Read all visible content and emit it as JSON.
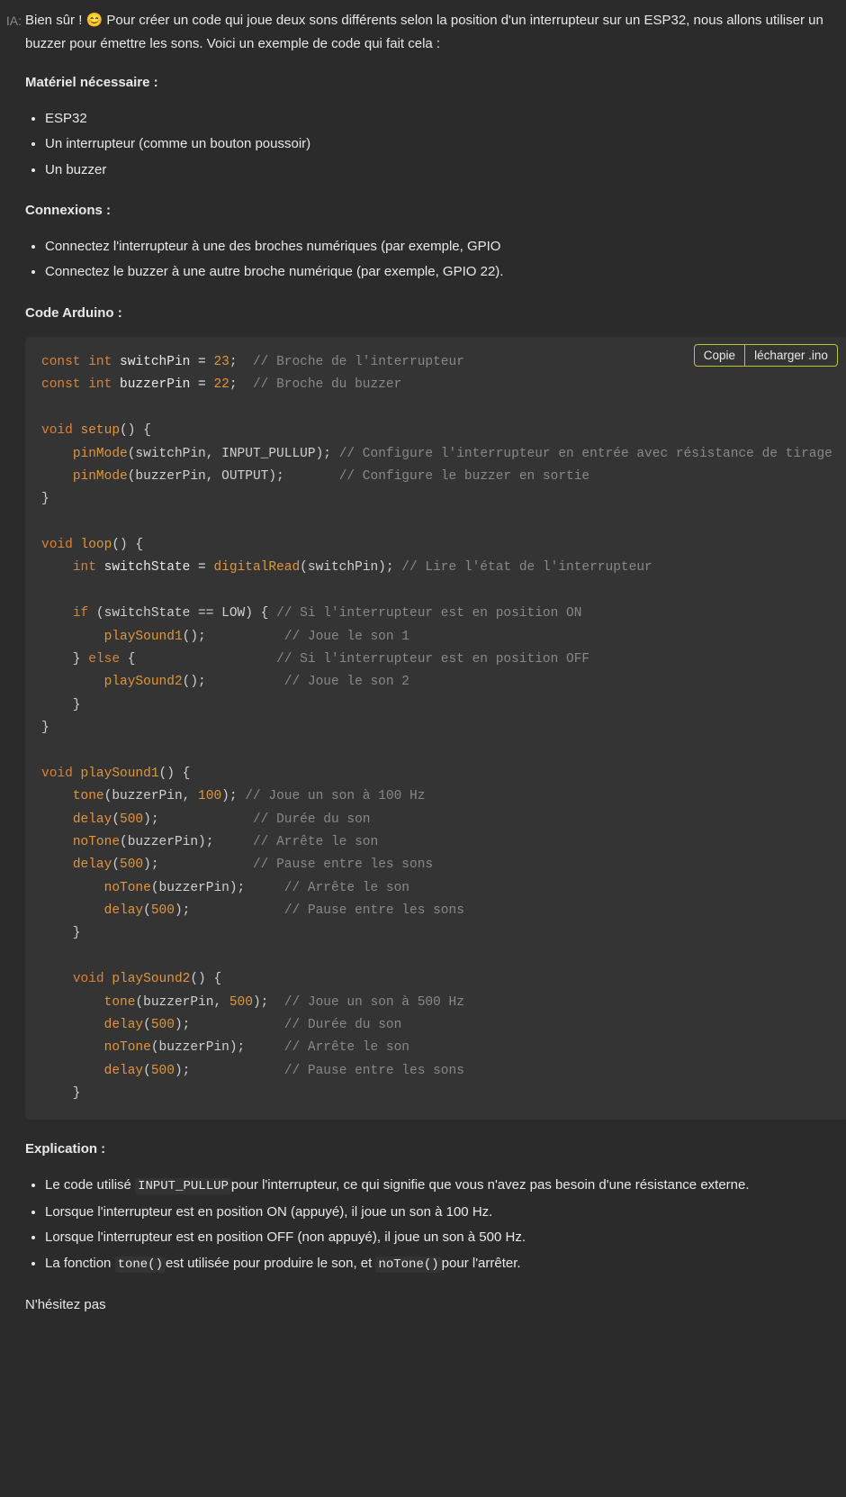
{
  "label": "IA:",
  "intro": {
    "pre": "Bien sûr ! ",
    "emoji": "😊",
    "post": " Pour créer un code qui joue deux sons différents selon la position d'un interrupteur sur un ESP32, nous allons utiliser un buzzer pour émettre les sons. Voici un exemple de code qui fait cela :"
  },
  "sections": {
    "materiel_title": "Matériel nécessaire :",
    "materiel_items": [
      "ESP32",
      "Un interrupteur (comme un bouton poussoir)",
      "Un buzzer"
    ],
    "connexions_title": "Connexions :",
    "connexions_items": [
      "Connectez l'interrupteur à une des broches numériques (par exemple, GPIO",
      "Connectez le buzzer à une autre broche numérique (par exemple, GPIO 22)."
    ],
    "code_title": "Code Arduino :",
    "explication_title": "Explication :"
  },
  "code": {
    "buttons": {
      "copy": "Copie",
      "download": "lécharger .ino"
    },
    "lines": [
      [
        [
          "kw",
          "const int"
        ],
        [
          "id",
          " switchPin = "
        ],
        [
          "num",
          "23"
        ],
        [
          "op",
          ";  "
        ],
        [
          "cm",
          "// Broche de l'interrupteur"
        ]
      ],
      [
        [
          "kw",
          "const int"
        ],
        [
          "id",
          " buzzerPin = "
        ],
        [
          "num",
          "22"
        ],
        [
          "op",
          ";  "
        ],
        [
          "cm",
          "// Broche du buzzer"
        ]
      ],
      [],
      [
        [
          "kw",
          "void"
        ],
        [
          "fn",
          " setup"
        ],
        [
          "op",
          "() {"
        ]
      ],
      [
        [
          "op",
          "    "
        ],
        [
          "fn",
          "pinMode"
        ],
        [
          "op",
          "(switchPin, INPUT_PULLUP); "
        ],
        [
          "cm",
          "// Configure l'interrupteur en entrée avec résistance de tirage"
        ]
      ],
      [
        [
          "op",
          "    "
        ],
        [
          "fn",
          "pinMode"
        ],
        [
          "op",
          "(buzzerPin, OUTPUT);       "
        ],
        [
          "cm",
          "// Configure le buzzer en sortie"
        ]
      ],
      [
        [
          "op",
          "}"
        ]
      ],
      [],
      [
        [
          "kw",
          "void"
        ],
        [
          "fn",
          " loop"
        ],
        [
          "op",
          "() {"
        ]
      ],
      [
        [
          "op",
          "    "
        ],
        [
          "kw",
          "int"
        ],
        [
          "id",
          " switchState = "
        ],
        [
          "fn",
          "digitalRead"
        ],
        [
          "op",
          "(switchPin); "
        ],
        [
          "cm",
          "// Lire l'état de l'interrupteur"
        ]
      ],
      [],
      [
        [
          "op",
          "    "
        ],
        [
          "kw",
          "if"
        ],
        [
          "op",
          " (switchState == LOW) { "
        ],
        [
          "cm",
          "// Si l'interrupteur est en position ON"
        ]
      ],
      [
        [
          "op",
          "        "
        ],
        [
          "fn",
          "playSound1"
        ],
        [
          "op",
          "();          "
        ],
        [
          "cm",
          "// Joue le son 1"
        ]
      ],
      [
        [
          "op",
          "    } "
        ],
        [
          "kw",
          "else"
        ],
        [
          "op",
          " {                  "
        ],
        [
          "cm",
          "// Si l'interrupteur est en position OFF"
        ]
      ],
      [
        [
          "op",
          "        "
        ],
        [
          "fn",
          "playSound2"
        ],
        [
          "op",
          "();          "
        ],
        [
          "cm",
          "// Joue le son 2"
        ]
      ],
      [
        [
          "op",
          "    }"
        ]
      ],
      [
        [
          "op",
          "}"
        ]
      ],
      [],
      [
        [
          "kw",
          "void"
        ],
        [
          "fn",
          " playSound1"
        ],
        [
          "op",
          "() {"
        ]
      ],
      [
        [
          "op",
          "    "
        ],
        [
          "fn",
          "tone"
        ],
        [
          "op",
          "(buzzerPin, "
        ],
        [
          "num",
          "100"
        ],
        [
          "op",
          "); "
        ],
        [
          "cm",
          "// Joue un son à 100 Hz"
        ]
      ],
      [
        [
          "op",
          "    "
        ],
        [
          "fn",
          "delay"
        ],
        [
          "op",
          "("
        ],
        [
          "num",
          "500"
        ],
        [
          "op",
          ");            "
        ],
        [
          "cm",
          "// Durée du son"
        ]
      ],
      [
        [
          "op",
          "    "
        ],
        [
          "fn",
          "noTone"
        ],
        [
          "op",
          "(buzzerPin);     "
        ],
        [
          "cm",
          "// Arrête le son"
        ]
      ],
      [
        [
          "op",
          "    "
        ],
        [
          "fn",
          "delay"
        ],
        [
          "op",
          "("
        ],
        [
          "num",
          "500"
        ],
        [
          "op",
          ");            "
        ],
        [
          "cm",
          "// Pause entre les sons"
        ]
      ],
      [
        [
          "op",
          "        "
        ],
        [
          "fn",
          "noTone"
        ],
        [
          "op",
          "(buzzerPin);     "
        ],
        [
          "cm",
          "// Arrête le son"
        ]
      ],
      [
        [
          "op",
          "        "
        ],
        [
          "fn",
          "delay"
        ],
        [
          "op",
          "("
        ],
        [
          "num",
          "500"
        ],
        [
          "op",
          ");            "
        ],
        [
          "cm",
          "// Pause entre les sons"
        ]
      ],
      [
        [
          "op",
          "    }"
        ]
      ],
      [],
      [
        [
          "op",
          "    "
        ],
        [
          "kw",
          "void"
        ],
        [
          "fn",
          " playSound2"
        ],
        [
          "op",
          "() {"
        ]
      ],
      [
        [
          "op",
          "        "
        ],
        [
          "fn",
          "tone"
        ],
        [
          "op",
          "(buzzerPin, "
        ],
        [
          "num",
          "500"
        ],
        [
          "op",
          ");  "
        ],
        [
          "cm",
          "// Joue un son à 500 Hz"
        ]
      ],
      [
        [
          "op",
          "        "
        ],
        [
          "fn",
          "delay"
        ],
        [
          "op",
          "("
        ],
        [
          "num",
          "500"
        ],
        [
          "op",
          ");            "
        ],
        [
          "cm",
          "// Durée du son"
        ]
      ],
      [
        [
          "op",
          "        "
        ],
        [
          "fn",
          "noTone"
        ],
        [
          "op",
          "(buzzerPin);     "
        ],
        [
          "cm",
          "// Arrête le son"
        ]
      ],
      [
        [
          "op",
          "        "
        ],
        [
          "fn",
          "delay"
        ],
        [
          "op",
          "("
        ],
        [
          "num",
          "500"
        ],
        [
          "op",
          ");            "
        ],
        [
          "cm",
          "// Pause entre les sons"
        ]
      ],
      [
        [
          "op",
          "    }"
        ]
      ]
    ]
  },
  "explication_items": [
    {
      "pre": "Le code utilisé ",
      "code1": "INPUT_PULLUP",
      "mid": "pour l'interrupteur, ce qui signifie que vous n'avez pas besoin d'une résistance externe.",
      "code2": "",
      "post": ""
    },
    {
      "pre": "Lorsque l'interrupteur est en position ON (appuyé), il joue un son à 100 Hz.",
      "code1": "",
      "mid": "",
      "code2": "",
      "post": ""
    },
    {
      "pre": "Lorsque l'interrupteur est en position OFF (non appuyé), il joue un son à 500 Hz.",
      "code1": "",
      "mid": "",
      "code2": "",
      "post": ""
    },
    {
      "pre": "La fonction ",
      "code1": "tone()",
      "mid": "est utilisée pour produire le son, et ",
      "code2": "noTone()",
      "post": "pour l'arrêter."
    }
  ],
  "outro": "N'hésitez pas"
}
